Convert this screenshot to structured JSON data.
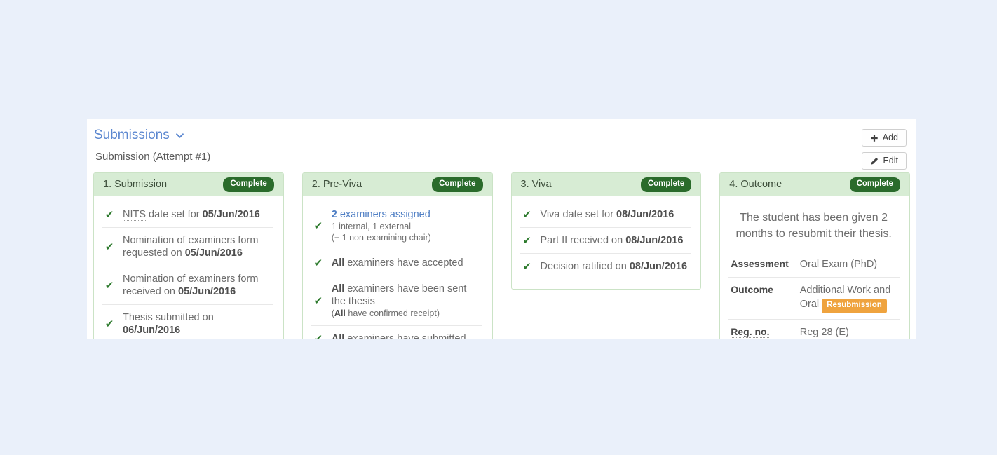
{
  "panel": {
    "title": "Submissions",
    "chevron_icon": "chevron-down-icon",
    "subtitle": "Submission (Attempt #1)",
    "buttons": [
      {
        "label": "Add",
        "icon": "plus-icon"
      },
      {
        "label": "Edit",
        "icon": "pencil-icon"
      }
    ]
  },
  "colors": {
    "page_bg": "#eaf0fa",
    "panel_bg": "#ffffff",
    "card_header_bg": "#d7ecd4",
    "card_border": "#cbe3c6",
    "badge_complete_bg": "#2a6b2b",
    "badge_resubmission_bg": "#efa33e",
    "link_blue": "#4e7ec4",
    "title_blue": "#5b87d0",
    "check_green": "#2d7a2d"
  },
  "cards": [
    {
      "title": "1. Submission",
      "status": "Complete",
      "rows": [
        {
          "icon": "check-icon",
          "parts": [
            {
              "text": "NITS",
              "style": "abbr"
            },
            {
              "text": " date set for ",
              "style": "plain"
            },
            {
              "text": "05/Jun/2016",
              "style": "bold"
            }
          ]
        },
        {
          "icon": "check-icon",
          "parts": [
            {
              "text": "Nomination of examiners form requested on ",
              "style": "plain"
            },
            {
              "text": "05/Jun/2016",
              "style": "bold"
            }
          ]
        },
        {
          "icon": "check-icon",
          "parts": [
            {
              "text": "Nomination of examiners form received on ",
              "style": "plain"
            },
            {
              "text": "05/Jun/2016",
              "style": "bold"
            }
          ]
        },
        {
          "icon": "check-icon",
          "parts": [
            {
              "text": "Thesis submitted on ",
              "style": "plain"
            },
            {
              "text": "06/Jun/2016",
              "style": "bold"
            }
          ]
        }
      ]
    },
    {
      "title": "2. Pre-Viva",
      "status": "Complete",
      "rows": [
        {
          "icon": "check-icon",
          "parts": [
            {
              "text": "2",
              "style": "link-bold"
            },
            {
              "text": " examiners assigned",
              "style": "link"
            }
          ],
          "sub_lines": [
            [
              {
                "text": "1 internal, 1 external",
                "style": "plain"
              }
            ],
            [
              {
                "text": "(+ 1 non-examining chair)",
                "style": "plain"
              }
            ]
          ]
        },
        {
          "icon": "check-icon",
          "parts": [
            {
              "text": "All",
              "style": "bold"
            },
            {
              "text": " examiners have accepted",
              "style": "plain"
            }
          ]
        },
        {
          "icon": "check-icon",
          "parts": [
            {
              "text": "All",
              "style": "bold"
            },
            {
              "text": " examiners have been sent the thesis",
              "style": "plain"
            }
          ],
          "sub_lines": [
            [
              {
                "text": "(",
                "style": "plain"
              },
              {
                "text": "All",
                "style": "bold"
              },
              {
                "text": " have confirmed receipt)",
                "style": "plain"
              }
            ]
          ]
        },
        {
          "icon": "check-icon",
          "parts": [
            {
              "text": "All",
              "style": "bold"
            },
            {
              "text": " examiners have submitted",
              "style": "plain"
            }
          ]
        }
      ]
    },
    {
      "title": "3. Viva",
      "status": "Complete",
      "rows": [
        {
          "icon": "check-icon",
          "parts": [
            {
              "text": "Viva date set for ",
              "style": "plain"
            },
            {
              "text": "08/Jun/2016",
              "style": "bold"
            }
          ]
        },
        {
          "icon": "check-icon",
          "parts": [
            {
              "text": "Part II received on ",
              "style": "plain"
            },
            {
              "text": "08/Jun/2016",
              "style": "bold"
            }
          ]
        },
        {
          "icon": "check-icon",
          "parts": [
            {
              "text": "Decision ratified on ",
              "style": "plain"
            },
            {
              "text": "08/Jun/2016",
              "style": "bold"
            }
          ]
        }
      ]
    },
    {
      "title": "4. Outcome",
      "status": "Complete",
      "lead_text": "The student has been given 2 months to resubmit their thesis.",
      "details": [
        {
          "key": "Assessment",
          "key_style": "plain",
          "value_parts": [
            {
              "text": "Oral Exam (PhD)",
              "style": "plain"
            }
          ]
        },
        {
          "key": "Outcome",
          "key_style": "plain",
          "value_parts": [
            {
              "text": "Additional Work and Oral ",
              "style": "plain"
            },
            {
              "text": "Resubmission",
              "style": "badge-orange"
            }
          ]
        },
        {
          "key": "Reg. no.",
          "key_style": "abbr",
          "value_parts": [
            {
              "text": "Reg 28 (E)",
              "style": "plain"
            }
          ]
        }
      ]
    }
  ]
}
